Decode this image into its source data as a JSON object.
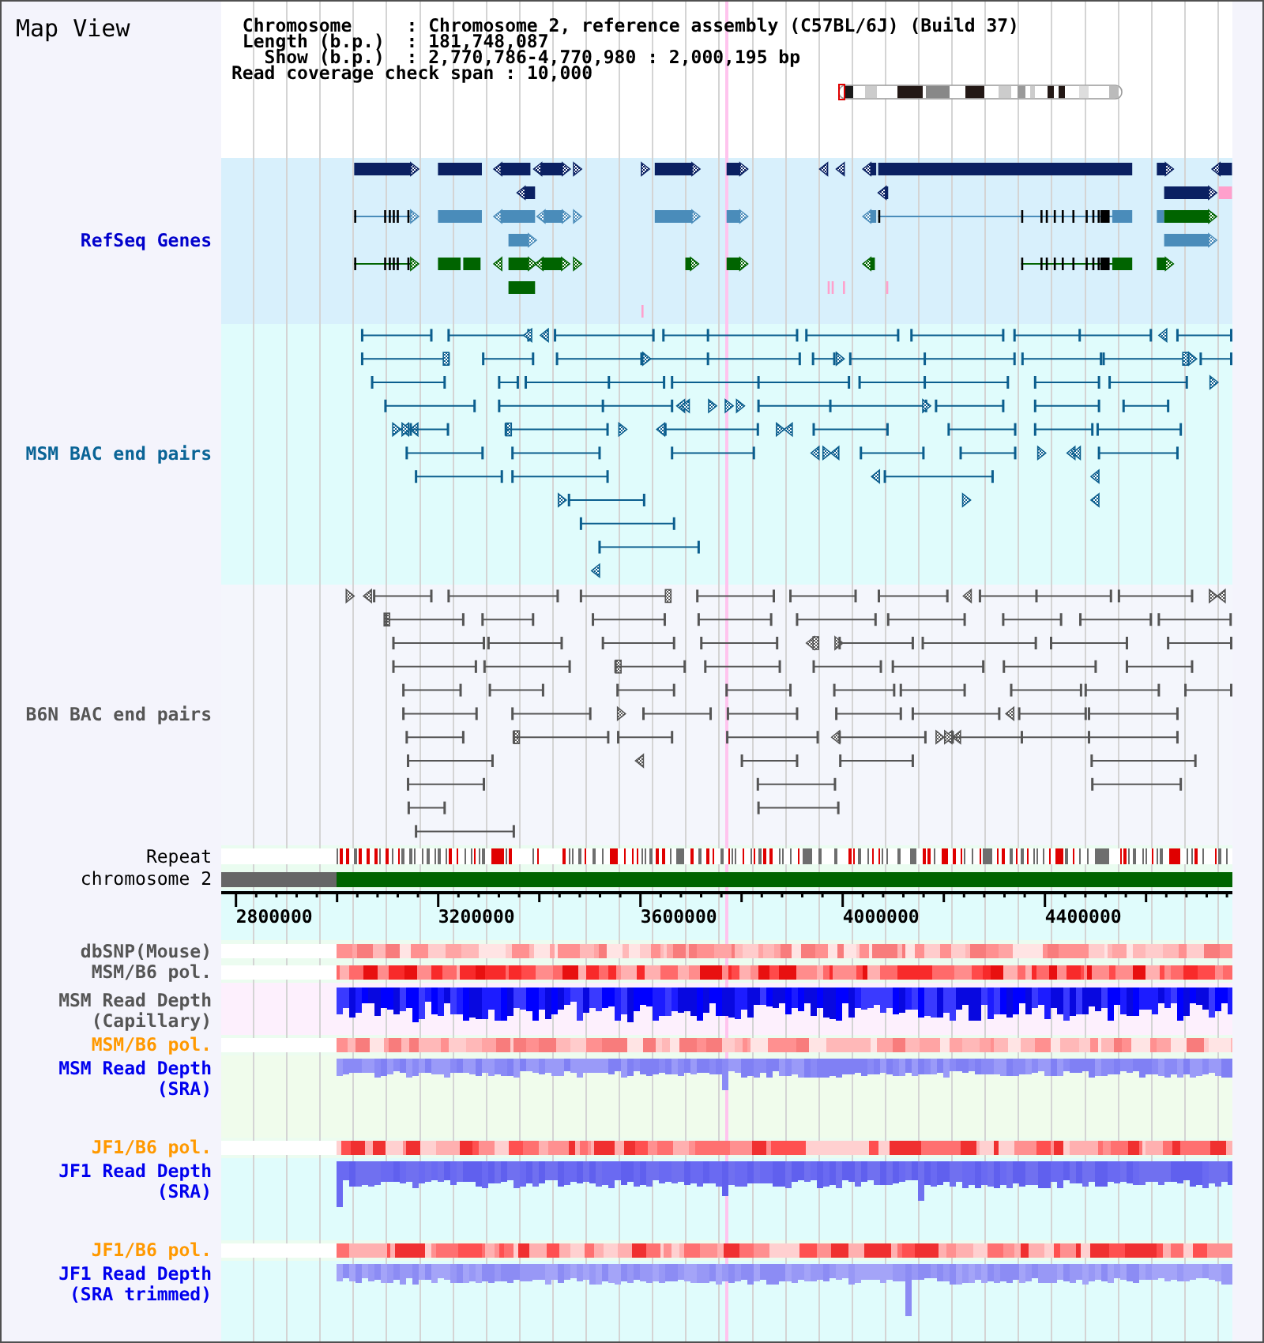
{
  "window": {
    "title": "Map View"
  },
  "info": [
    {
      "label": "Chromosome",
      "separator": ":",
      "value": "Chromosome 2, reference assembly (C57BL/6J) (Build 37)"
    },
    {
      "label": "Length (b.p.)",
      "separator": ":",
      "value": "181,748,087"
    },
    {
      "label": "Show (b.p.)",
      "separator": ":",
      "value": "2,770,786-4,770,980 : 2,000,195 bp"
    }
  ],
  "coverage": {
    "label": "Read coverage check span",
    "separator": ":",
    "value": "10,000"
  },
  "tracks": [
    {
      "kind": "genes",
      "label": "RefSeq Genes",
      "color": "#0000cc"
    },
    {
      "kind": "bac-pairs",
      "label": "MSM BAC end pairs",
      "color": "#0a6496"
    },
    {
      "kind": "bac-pairs",
      "label": "B6N BAC end pairs",
      "color": "#555555"
    },
    {
      "kind": "repeat",
      "label": "Repeat",
      "color": "#000000"
    },
    {
      "kind": "chromosome",
      "label": "chromosome 2",
      "color": "#000000"
    },
    {
      "kind": "axis",
      "ticks": [
        "2800000",
        "3200000",
        "3600000",
        "4000000",
        "4400000"
      ]
    },
    {
      "kind": "heatmap",
      "label": "dbSNP(Mouse)",
      "color": "#555555"
    },
    {
      "kind": "heatmap",
      "label": "MSM/B6 pol.",
      "color": "#555555"
    },
    {
      "kind": "depth",
      "label": "MSM Read Depth (Capillary)",
      "color": "#555555"
    },
    {
      "kind": "heatmap",
      "label": "MSM/B6 pol.",
      "color": "#ff9900"
    },
    {
      "kind": "depth",
      "label": "MSM Read Depth (SRA)",
      "color": "#0000ee"
    },
    {
      "kind": "heatmap",
      "label": "JF1/B6 pol.",
      "color": "#ff9900"
    },
    {
      "kind": "depth",
      "label": "JF1 Read Depth (SRA)",
      "color": "#0000ee"
    },
    {
      "kind": "heatmap",
      "label": "JF1/B6 pol.",
      "color": "#ff9900"
    },
    {
      "kind": "depth",
      "label": "JF1 Read Depth (SRA trimmed)",
      "color": "#0000ee"
    }
  ]
}
